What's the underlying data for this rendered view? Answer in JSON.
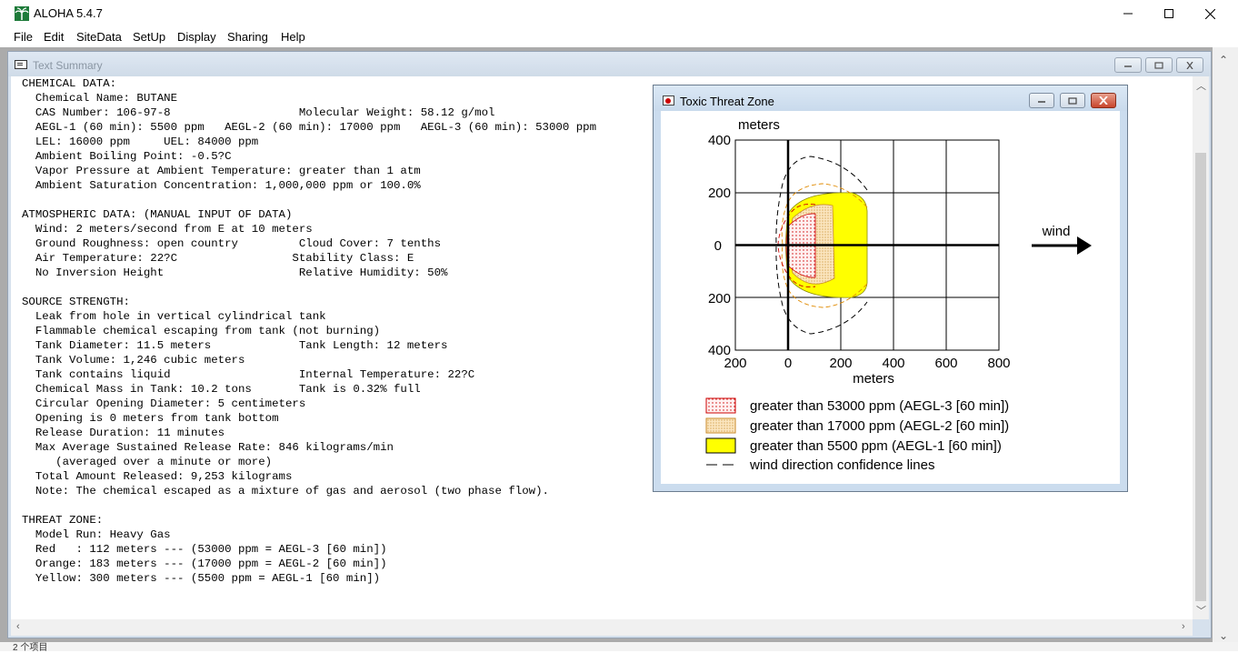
{
  "app": {
    "title": "ALOHA 5.4.7",
    "menu": [
      "File",
      "Edit",
      "SiteData",
      "SetUp",
      "Display",
      "Sharing",
      "Help"
    ]
  },
  "text_summary": {
    "title": "Text Summary",
    "lines": [
      "CHEMICAL DATA:",
      "  Chemical Name: BUTANE",
      "  CAS Number: 106-97-8                   Molecular Weight: 58.12 g/mol",
      "  AEGL-1 (60 min): 5500 ppm   AEGL-2 (60 min): 17000 ppm   AEGL-3 (60 min): 53000 ppm",
      "  LEL: 16000 ppm     UEL: 84000 ppm",
      "  Ambient Boiling Point: -0.5?C",
      "  Vapor Pressure at Ambient Temperature: greater than 1 atm",
      "  Ambient Saturation Concentration: 1,000,000 ppm or 100.0%",
      "",
      "ATMOSPHERIC DATA: (MANUAL INPUT OF DATA)",
      "  Wind: 2 meters/second from E at 10 meters",
      "  Ground Roughness: open country         Cloud Cover: 7 tenths",
      "  Air Temperature: 22?C                 Stability Class: E",
      "  No Inversion Height                    Relative Humidity: 50%",
      "",
      "SOURCE STRENGTH:",
      "  Leak from hole in vertical cylindrical tank",
      "  Flammable chemical escaping from tank (not burning)",
      "  Tank Diameter: 11.5 meters             Tank Length: 12 meters",
      "  Tank Volume: 1,246 cubic meters",
      "  Tank contains liquid                   Internal Temperature: 22?C",
      "  Chemical Mass in Tank: 10.2 tons       Tank is 0.32% full",
      "  Circular Opening Diameter: 5 centimeters",
      "  Opening is 0 meters from tank bottom",
      "  Release Duration: 11 minutes",
      "  Max Average Sustained Release Rate: 846 kilograms/min",
      "     (averaged over a minute or more)",
      "  Total Amount Released: 9,253 kilograms",
      "  Note: The chemical escaped as a mixture of gas and aerosol (two phase flow).",
      "",
      "THREAT ZONE:",
      "  Model Run: Heavy Gas",
      "  Red   : 112 meters --- (53000 ppm = AEGL-3 [60 min])",
      "  Orange: 183 meters --- (17000 ppm = AEGL-2 [60 min])",
      "  Yellow: 300 meters --- (5500 ppm = AEGL-1 [60 min])"
    ]
  },
  "threat_zone": {
    "title": "Toxic Threat Zone",
    "wind_label": "wind",
    "y_axis_label": "meters",
    "x_axis_label": "meters",
    "y_ticks": [
      "400",
      "200",
      "0",
      "200",
      "400"
    ],
    "x_ticks": [
      "200",
      "0",
      "200",
      "400",
      "600",
      "800"
    ],
    "legend": [
      "greater than 53000 ppm (AEGL-3 [60 min])",
      "greater than 17000 ppm (AEGL-2 [60 min])",
      "greater than 5500 ppm (AEGL-1 [60 min])",
      "wind direction confidence lines"
    ],
    "colors": {
      "red": "#cc0000",
      "orange": "#e08a00",
      "yellow": "#ffff00"
    }
  },
  "status_partial": "2 个项目"
}
